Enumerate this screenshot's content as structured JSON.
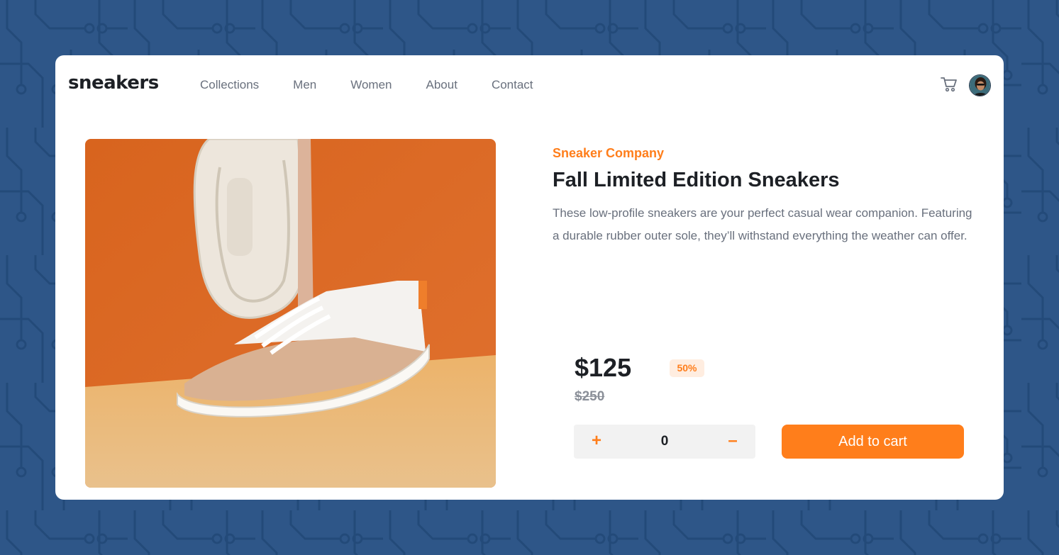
{
  "brand": {
    "logo_text": "sneakers"
  },
  "nav": {
    "items": [
      {
        "label": "Collections"
      },
      {
        "label": "Men"
      },
      {
        "label": "Women"
      },
      {
        "label": "About"
      },
      {
        "label": "Contact"
      }
    ]
  },
  "header": {
    "cart_icon": "cart-icon",
    "avatar": "user-avatar"
  },
  "product": {
    "company": "Sneaker Company",
    "title": "Fall Limited Edition Sneakers",
    "description": "These low-profile sneakers are your perfect casual wear companion. Featuring a durable rubber outer sole, they’ll withstand everything the weather can offer.",
    "price": "$125",
    "discount": "50%",
    "old_price": "$250"
  },
  "cart_controls": {
    "plus": "+",
    "minus": "–",
    "quantity": "0",
    "add_label": "Add to cart"
  },
  "colors": {
    "accent": "#ff7e1b",
    "background": "#2e5688",
    "text_dark": "#1d2025",
    "text_muted": "#69707d"
  }
}
